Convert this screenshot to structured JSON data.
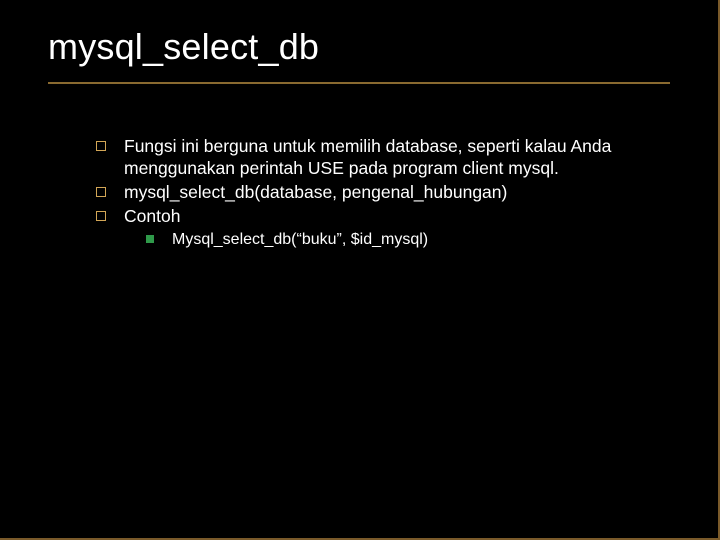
{
  "title": "mysql_select_db",
  "bullets": {
    "b1": "Fungsi ini berguna untuk memilih database, seperti kalau Anda menggunakan perintah USE pada program client mysql.",
    "b2": "mysql_select_db(database, pengenal_hubungan)",
    "b3": "Contoh",
    "b3_sub1": "Mysql_select_db(“buku”, $id_mysql)"
  }
}
